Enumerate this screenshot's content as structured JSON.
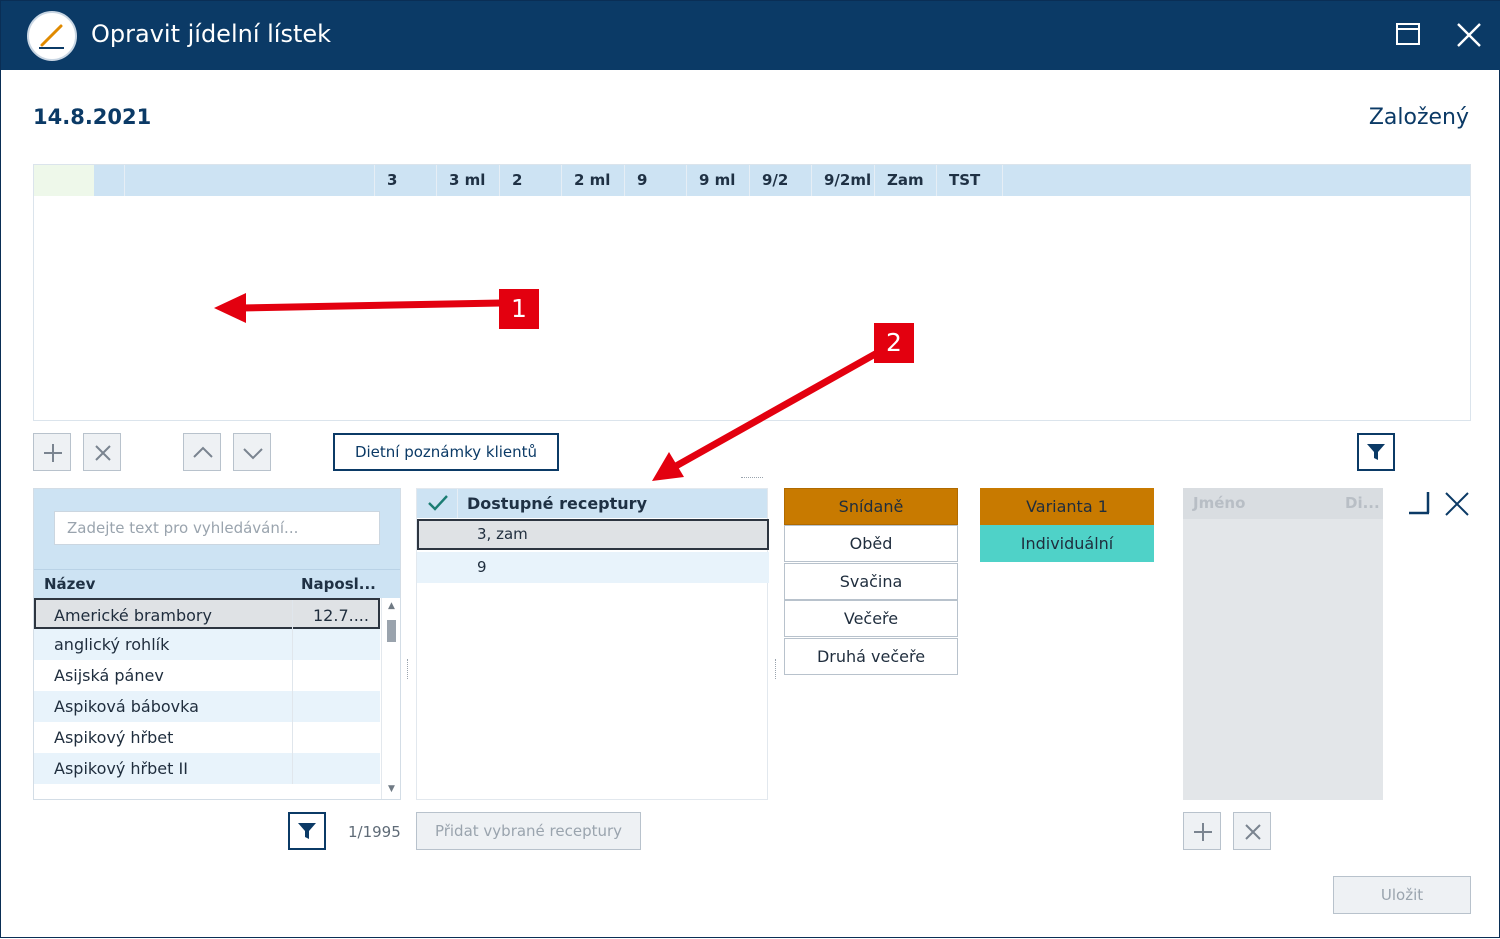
{
  "window": {
    "title": "Opravit jídelní lístek"
  },
  "header": {
    "date": "14.8.2021",
    "state": "Založený"
  },
  "grid": {
    "columns": [
      "3",
      "3 ml",
      "2",
      "2 ml",
      "9",
      "9 ml",
      "9/2",
      "9/2ml",
      "Zam",
      "TST"
    ]
  },
  "toolbar": {
    "diet_notes_label": "Dietní poznámky klientů"
  },
  "recipes": {
    "search_placeholder": "Zadejte text pro vyhledávání...",
    "col_name": "Název",
    "col_last": "Naposl...",
    "items": [
      {
        "name": "Americké brambory",
        "last": "12.7...."
      },
      {
        "name": "anglický rohlík",
        "last": ""
      },
      {
        "name": "Asijská pánev",
        "last": ""
      },
      {
        "name": "Aspiková bábovka",
        "last": ""
      },
      {
        "name": "Aspikový hřbet",
        "last": ""
      },
      {
        "name": "Aspikový hřbet II",
        "last": ""
      }
    ],
    "pager": "1/1995",
    "add_selected_label": "Přidat vybrané receptury"
  },
  "available": {
    "header": "Dostupné receptury",
    "items": [
      "3, zam",
      "9"
    ]
  },
  "meals": [
    "Snídaně",
    "Oběd",
    "Svačina",
    "Večeře",
    "Druhá večeře"
  ],
  "variants": [
    "Varianta 1",
    "Individuální"
  ],
  "people": {
    "col_name": "Jméno",
    "col_diet": "Di..."
  },
  "save_label": "Uložit",
  "callouts": [
    "1",
    "2"
  ],
  "colors": {
    "titlebar": "#0b3a66",
    "header_blue": "#cde3f3",
    "active_orange": "#c87a00",
    "individual_teal": "#4fd2c8",
    "callout_red": "#e3000f"
  }
}
